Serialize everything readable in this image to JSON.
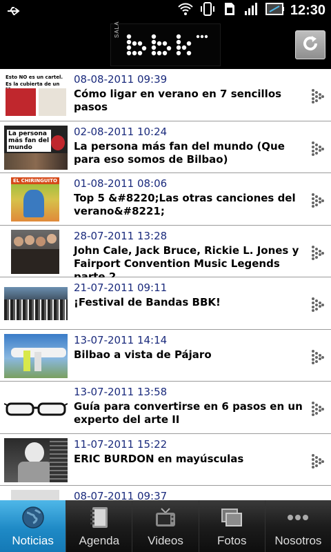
{
  "status_bar": {
    "time": "12:30",
    "icons": [
      "usb-icon",
      "wifi-icon",
      "vibrate-icon",
      "sim-icon",
      "signal-icon",
      "battery-icon"
    ]
  },
  "header": {
    "logo_text": "SALA bbk",
    "logo_small": "SALA",
    "refresh_icon": "refresh-icon"
  },
  "news": [
    {
      "date": "08-08-2011 09:39",
      "title": "Cómo ligar en verano en 7 sencillos pasos",
      "thumb_text_1": "Esto NO es un cartel.",
      "thumb_text_2": "Es la cubierta de un libro."
    },
    {
      "date": "02-08-2011 10:24",
      "title": "La persona más fan del mundo (Que para eso somos de Bilbao)",
      "thumb_text_1": "La persona",
      "thumb_text_2": "más fan del mundo"
    },
    {
      "date": "01-08-2011 08:06",
      "title": "Top 5 &#8220;Las otras canciones del verano&#8221;",
      "thumb_text_1": "EL CHIRINGUITO",
      "thumb_text_2": ""
    },
    {
      "date": "28-07-2011 13:28",
      "title": "John Cale, Jack Bruce, Rickie L. Jones y Fairport Convention Music Legends parte 2",
      "thumb_text_1": "",
      "thumb_text_2": ""
    },
    {
      "date": "21-07-2011 09:11",
      "title": "¡Festival de Bandas BBK!",
      "thumb_text_1": "",
      "thumb_text_2": ""
    },
    {
      "date": "13-07-2011 14:14",
      "title": "Bilbao a vista de Pájaro",
      "thumb_text_1": "",
      "thumb_text_2": ""
    },
    {
      "date": "13-07-2011 13:58",
      "title": "Guía para convertirse en 6 pasos en un experto del arte II",
      "thumb_text_1": "",
      "thumb_text_2": ""
    },
    {
      "date": "11-07-2011 15:22",
      "title": "ERIC BURDON en mayúsculas",
      "thumb_text_1": "",
      "thumb_text_2": ""
    },
    {
      "date": "08-07-2011 09:37",
      "title": "",
      "thumb_text_1": "",
      "thumb_text_2": ""
    }
  ],
  "tabs": [
    {
      "label": "Noticias",
      "icon": "globe-icon",
      "active": true
    },
    {
      "label": "Agenda",
      "icon": "notebook-icon",
      "active": false
    },
    {
      "label": "Videos",
      "icon": "tv-icon",
      "active": false
    },
    {
      "label": "Fotos",
      "icon": "photos-icon",
      "active": false
    },
    {
      "label": "Nosotros",
      "icon": "more-dots-icon",
      "active": false
    }
  ],
  "colors": {
    "date": "#1a2a7c",
    "tab_active": "#1f8ac6"
  }
}
